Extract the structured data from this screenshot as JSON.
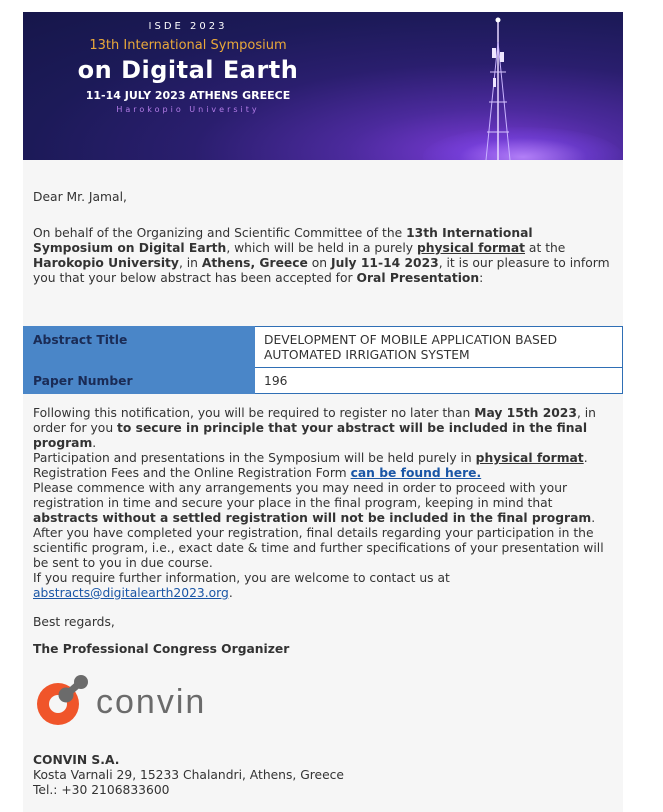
{
  "banner": {
    "line1": "ISDE 2023",
    "line2": "13th International Symposium",
    "line3": "on Digital Earth",
    "line4": "11-14 JULY 2023   ATHENS GREECE",
    "line5": "Harokopio University"
  },
  "greeting": "Dear Mr. Jamal,",
  "intro": {
    "p1": "On behalf of the Organizing and Scientific Committee of the ",
    "b1": "13th International Symposium on Digital Earth",
    "p2": ", which will be held in a purely ",
    "u1": "physical format",
    "p3": " at the ",
    "b2": "Harokopio University",
    "p4": ", in ",
    "b3": "Athens, Greece",
    "p5": " on ",
    "b4": "July 11-14 2023",
    "p6": ", it is our pleasure to inform you that your below abstract has been accepted for ",
    "b5": "Oral Presentation",
    "p7": ":"
  },
  "table": {
    "title_label": "Abstract Title",
    "title_value": "DEVELOPMENT OF MOBILE APPLICATION BASED AUTOMATED IRRIGATION SYSTEM",
    "number_label": "Paper Number",
    "number_value": "196"
  },
  "body": {
    "a1": "Following this notification, you will be required to register no later than ",
    "a2": "May 15th 2023",
    "a3": ", in order for you ",
    "a4": "to secure in principle that your abstract will be included in the final program",
    "a5": ".",
    "b1": "Participation and presentations in the Symposium will be held purely in ",
    "b2": "physical format",
    "b3": ".",
    "c1": "Registration Fees and the Online Registration Form ",
    "c2": "can be found here.",
    "d1": "Please commence with any arrangements you may need in order to proceed with your registration in time and secure your place in the final program, keeping in mind that ",
    "d2": "abstracts without a settled registration will not be included in the final program",
    "d3": ".",
    "e1": "After you have completed your registration, final details regarding your participation in the scientific program, i.e., exact date & time and further specifications of your presentation will be sent to you in due course.",
    "f1": "If you require further information, you are welcome to contact us at ",
    "f2": "abstracts@digitalearth2023.org",
    "f3": "."
  },
  "regards": "Best regards,",
  "signature": "The Professional Congress Organizer",
  "logo": {
    "text": "convin",
    "colors": {
      "orange": "#f0552a",
      "gray": "#6b6b6b"
    }
  },
  "company": {
    "name": "CONVIN S.A.",
    "address": "Kosta Varnali 29, 15233 Chalandri, Athens, Greece",
    "tel": "Tel.: +30 2106833600"
  }
}
